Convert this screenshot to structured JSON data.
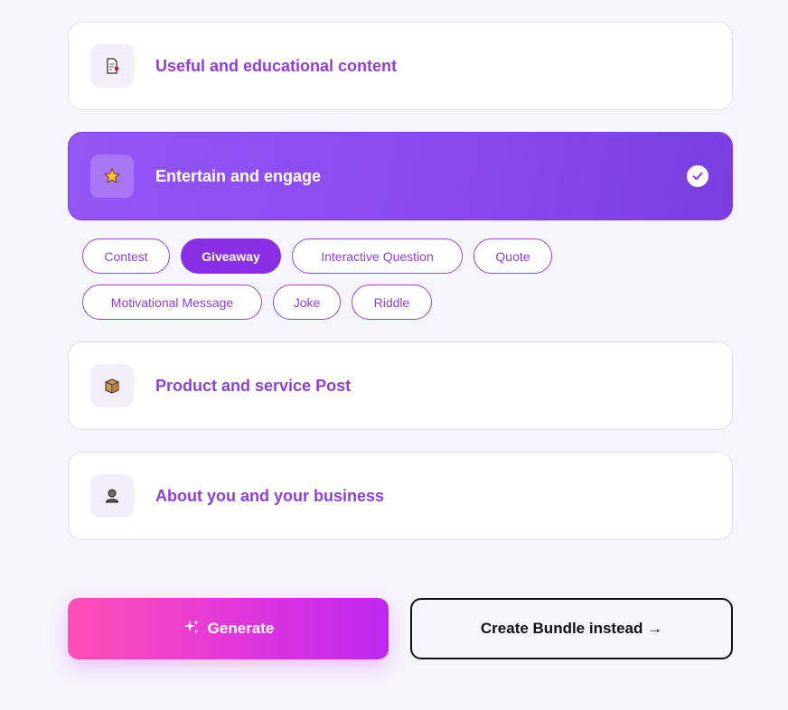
{
  "categories": [
    {
      "label": "Useful and educational content",
      "icon": "document-icon",
      "selected": false
    },
    {
      "label": "Entertain and engage",
      "icon": "star-icon",
      "selected": true
    },
    {
      "label": "Product and service Post",
      "icon": "box-icon",
      "selected": false
    },
    {
      "label": "About you and your business",
      "icon": "person-icon",
      "selected": false
    }
  ],
  "chips": [
    {
      "label": "Contest",
      "selected": false
    },
    {
      "label": "Giveaway",
      "selected": true
    },
    {
      "label": "Interactive Question",
      "selected": false
    },
    {
      "label": "Quote",
      "selected": false
    },
    {
      "label": "Motivational Message",
      "selected": false
    },
    {
      "label": "Joke",
      "selected": false
    },
    {
      "label": "Riddle",
      "selected": false
    }
  ],
  "actions": {
    "generate_label": "Generate",
    "bundle_label": "Create Bundle instead →"
  },
  "colors": {
    "accent": "#8d3fd6",
    "active_card": "#8a4af0",
    "chip_selected": "#8b2fe6",
    "generate_start": "#ff4fb4",
    "generate_end": "#bd27f0"
  }
}
